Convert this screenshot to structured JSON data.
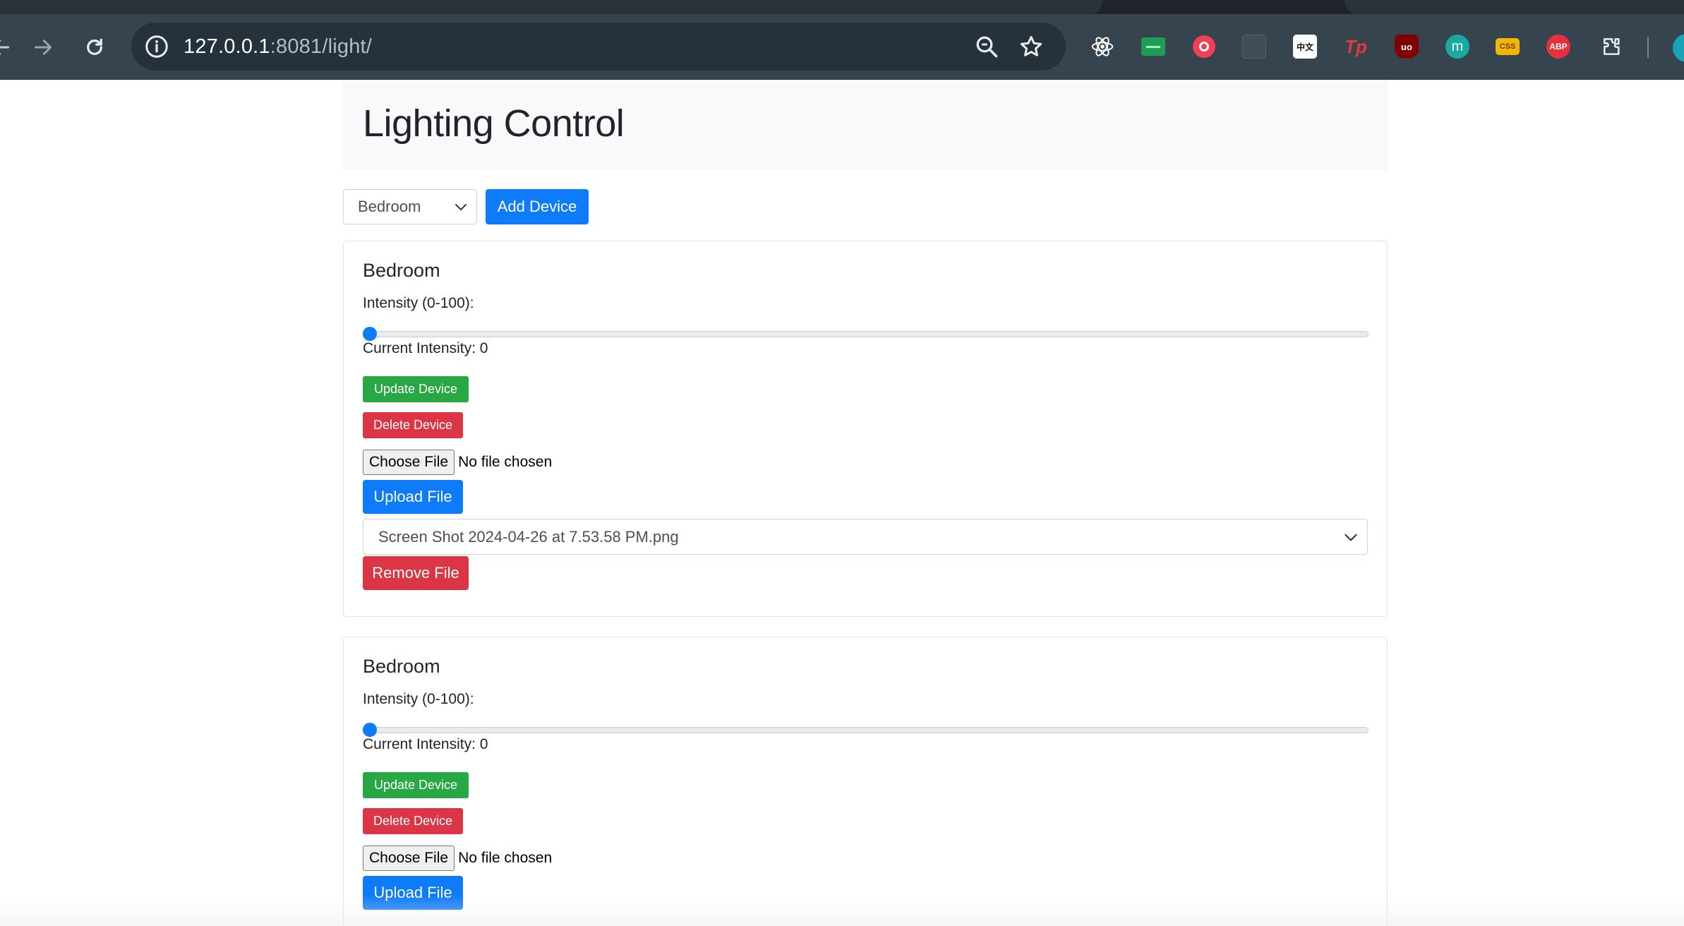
{
  "browser": {
    "url_host": "127.0.0.1",
    "url_rest": ":8081/light/",
    "extensions": [
      {
        "name": "react-devtools-icon",
        "label": ""
      },
      {
        "name": "screen-reader-icon",
        "label": ""
      },
      {
        "name": "pocket-icon",
        "label": ""
      },
      {
        "name": "grid-extension-icon",
        "label": ""
      },
      {
        "name": "chinese-translate-icon",
        "label": "中文"
      },
      {
        "name": "tp-extension-icon",
        "label": "Tp"
      },
      {
        "name": "ublock-icon",
        "label": "uo"
      },
      {
        "name": "m-extension-icon",
        "label": "m"
      },
      {
        "name": "css-extension-icon",
        "label": "CSS"
      },
      {
        "name": "adblock-plus-icon",
        "label": "ABP"
      },
      {
        "name": "extensions-puzzle-icon",
        "label": ""
      }
    ]
  },
  "page": {
    "title": "Lighting Control",
    "room_select_value": "Bedroom",
    "add_device_label": "Add Device"
  },
  "devices": [
    {
      "name": "Bedroom",
      "intensity_label": "Intensity (0-100):",
      "intensity": 0,
      "current_intensity_label": "Current Intensity: 0",
      "update_label": "Update Device",
      "delete_label": "Delete Device",
      "choose_file_label": "Choose File",
      "no_file_label": "No file chosen",
      "upload_label": "Upload File",
      "selected_file": "Screen Shot 2024-04-26 at 7.53.58 PM.png",
      "remove_label": "Remove File"
    },
    {
      "name": "Bedroom",
      "intensity_label": "Intensity (0-100):",
      "intensity": 0,
      "current_intensity_label": "Current Intensity: 0",
      "update_label": "Update Device",
      "delete_label": "Delete Device",
      "choose_file_label": "Choose File",
      "no_file_label": "No file chosen",
      "upload_label": "Upload File"
    }
  ],
  "colors": {
    "primary": "#0d7bfa",
    "success": "#28a745",
    "danger": "#dc3545",
    "jumbotron_bg": "#f8f9fa",
    "chrome_toolbar": "#35444f"
  }
}
